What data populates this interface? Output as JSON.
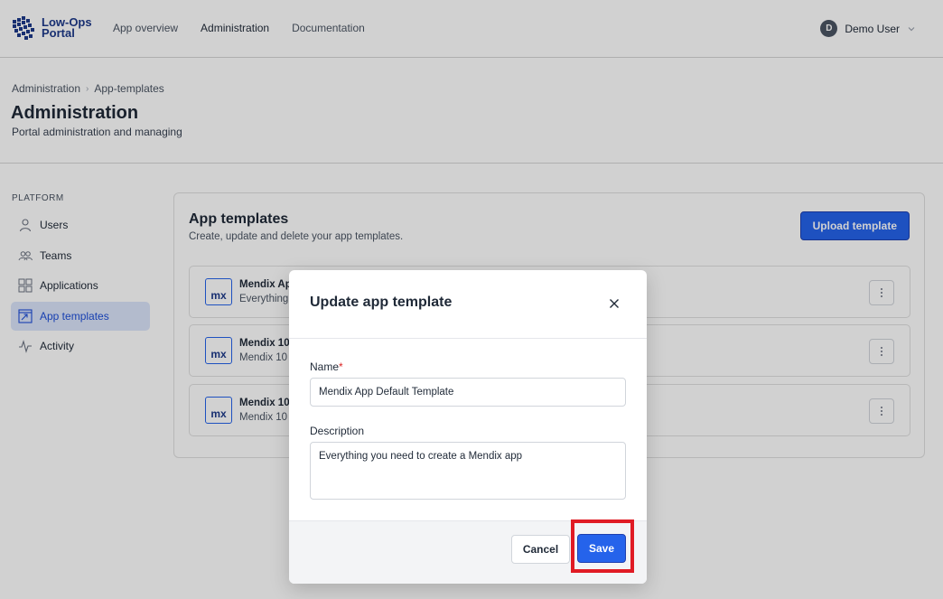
{
  "header": {
    "logo_line1": "Low-Ops",
    "logo_line2": "Portal",
    "nav": [
      {
        "label": "App overview"
      },
      {
        "label": "Administration"
      },
      {
        "label": "Documentation"
      }
    ],
    "user": {
      "initial": "D",
      "name": "Demo User"
    }
  },
  "page": {
    "breadcrumb": [
      "Administration",
      "App-templates"
    ],
    "title": "Administration",
    "subtitle": "Portal administration and managing"
  },
  "sidebar": {
    "heading": "PLATFORM",
    "items": [
      {
        "label": "Users",
        "icon": "user-icon"
      },
      {
        "label": "Teams",
        "icon": "teams-icon"
      },
      {
        "label": "Applications",
        "icon": "grid-icon"
      },
      {
        "label": "App templates",
        "icon": "template-icon",
        "active": true
      },
      {
        "label": "Activity",
        "icon": "activity-icon"
      }
    ]
  },
  "templates_card": {
    "title": "App templates",
    "subtitle": "Create, update and delete your app templates.",
    "upload_label": "Upload template",
    "rows": [
      {
        "icon_text": "mx",
        "name": "Mendix Ap",
        "desc": "Everything"
      },
      {
        "icon_text": "mx",
        "name": "Mendix 10",
        "desc": "Mendix 10"
      },
      {
        "icon_text": "mx",
        "name": "Mendix 10",
        "desc": "Mendix 10"
      }
    ]
  },
  "modal": {
    "title": "Update app template",
    "name_label": "Name",
    "name_required_mark": "*",
    "name_value": "Mendix App Default Template",
    "description_label": "Description",
    "description_value": "Everything you need to create a Mendix app",
    "cancel_label": "Cancel",
    "save_label": "Save"
  },
  "colors": {
    "primary": "#2563eb",
    "active_nav_bg": "#dbe5fb",
    "highlight": "#e01b24"
  }
}
